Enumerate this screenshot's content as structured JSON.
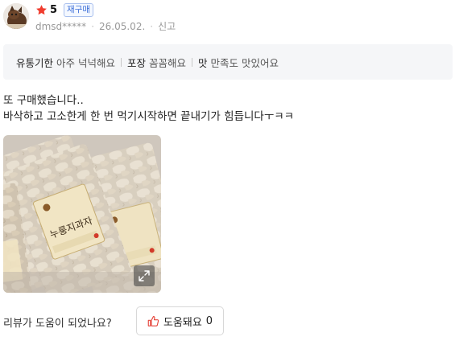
{
  "review": {
    "rating": "5",
    "badge": "재구매",
    "author": "dmsd*****",
    "date": "26.05.02.",
    "report_label": "신고",
    "attributes": [
      {
        "key": "유통기한",
        "value": "아주 넉넉해요"
      },
      {
        "key": "포장",
        "value": "꼼꼼해요"
      },
      {
        "key": "맛",
        "value": "만족도 맛있어요"
      }
    ],
    "text_lines": [
      "또 구매했습니다..",
      "바삭하고 고소한게 한 번 먹기시작하면 끝내기가 힘듭니다ㅜㅋㅋ"
    ]
  },
  "photo": {
    "package_label": "누룽지과자"
  },
  "helpful": {
    "question": "리뷰가 도움이 되었나요?",
    "button_label": "도움돼요",
    "count": "0"
  },
  "colors": {
    "star": "#f03c2e",
    "badge_text": "#3d6fd8",
    "attr_bg": "#f5f6f8",
    "thumb_icon": "#e5453b"
  },
  "icons": {
    "star": "star-icon",
    "expand": "expand-icon",
    "thumbs_up": "thumbs-up-icon",
    "avatar": "avatar-image"
  }
}
